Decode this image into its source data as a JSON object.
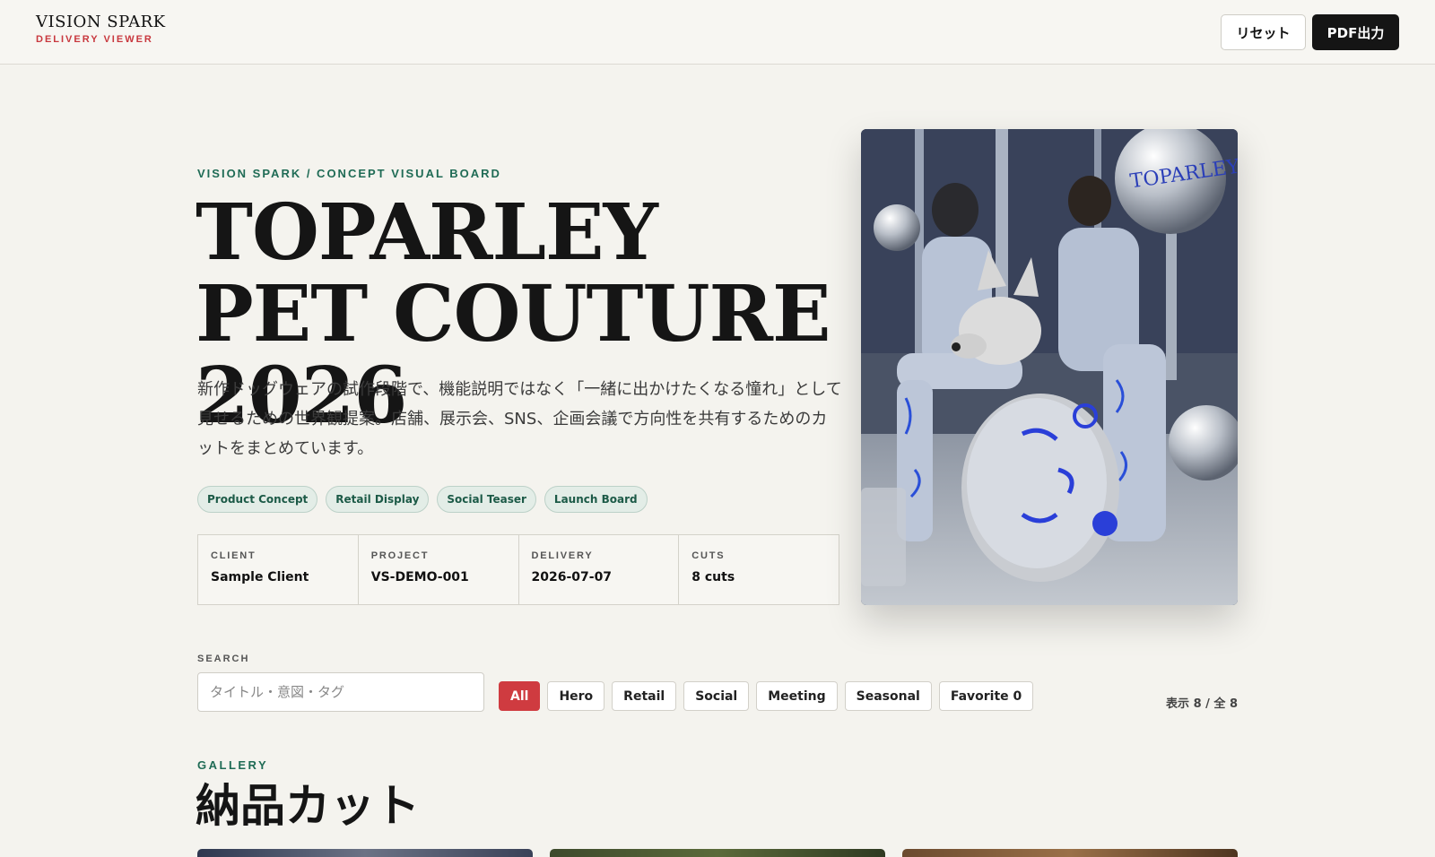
{
  "header": {
    "brand_name": "VISION SPARK",
    "brand_sub": "DELIVERY VIEWER",
    "reset_label": "リセット",
    "pdf_label": "PDF出力"
  },
  "hero": {
    "eyebrow": "VISION SPARK / CONCEPT VISUAL BOARD",
    "title": "TOPARLEY PET COUTURE 2026",
    "description": "新作ドッグウェアの試作段階で、機能説明ではなく「一緒に出かけたくなる憧れ」として見せるための世界観提案。店舗、展示会、SNS、企画会議で方向性を共有するためのカットをまとめています。",
    "tags": [
      "Product Concept",
      "Retail Display",
      "Social Teaser",
      "Launch Board"
    ],
    "image_text": "TOPARLEY"
  },
  "meta": [
    {
      "label": "CLIENT",
      "value": "Sample Client"
    },
    {
      "label": "PROJECT",
      "value": "VS-DEMO-001"
    },
    {
      "label": "DELIVERY",
      "value": "2026-07-07"
    },
    {
      "label": "CUTS",
      "value": "8 cuts"
    }
  ],
  "search": {
    "label": "SEARCH",
    "placeholder": "タイトル・意図・タグ",
    "filters": [
      "All",
      "Hero",
      "Retail",
      "Social",
      "Meeting",
      "Seasonal",
      "Favorite 0"
    ],
    "active_filter": "All",
    "count_text": "表示 8 / 全 8"
  },
  "gallery": {
    "eyebrow": "GALLERY",
    "title": "納品カット"
  },
  "colors": {
    "accent_red": "#cf3b40",
    "accent_green": "#1f6b55",
    "background": "#f4f3ee",
    "dark_button": "#151515"
  }
}
